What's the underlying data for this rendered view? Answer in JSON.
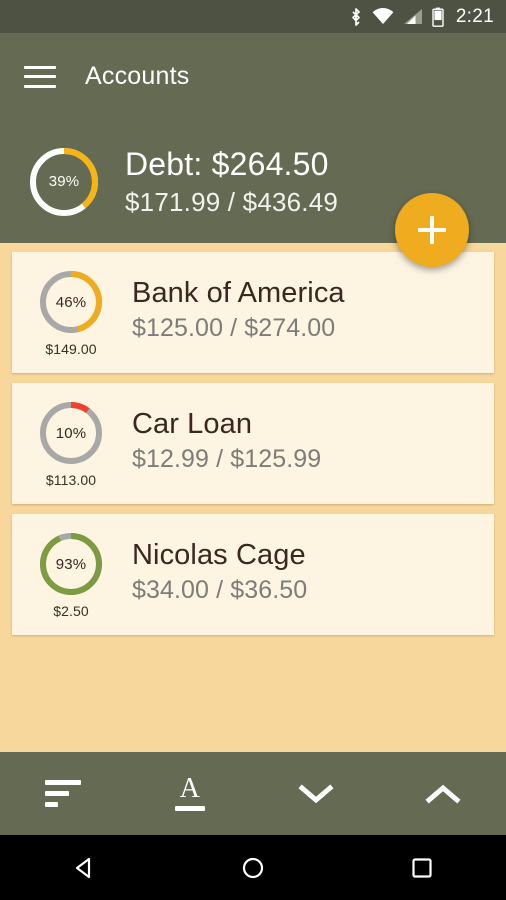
{
  "statusbar": {
    "time": "2:21",
    "icons": [
      "bluetooth-icon",
      "wifi-icon",
      "cell-signal-icon",
      "battery-icon"
    ]
  },
  "appbar": {
    "menu_icon": "hamburger-menu-icon",
    "title": "Accounts"
  },
  "summary": {
    "percent_label": "39%",
    "percent_value": 39,
    "title": "Debt: $264.50",
    "subtitle": "$171.99 / $436.49",
    "ring_track_color": "#FFFFFF",
    "ring_arc_color": "#F5B512"
  },
  "fab": {
    "icon": "plus-icon",
    "label": "+",
    "color": "#EFAC1E"
  },
  "accounts": [
    {
      "name": "Bank of America",
      "percent_label": "46%",
      "percent_value": 46,
      "remaining": "$149.00",
      "progress": "$125.00 / $274.00",
      "ring_arc_color": "#EFAC1E",
      "ring_track_color": "#A8A8A8"
    },
    {
      "name": "Car Loan",
      "percent_label": "10%",
      "percent_value": 10,
      "remaining": "$113.00",
      "progress": "$12.99 / $125.99",
      "ring_arc_color": "#F0412F",
      "ring_track_color": "#A8A8A8"
    },
    {
      "name": "Nicolas Cage",
      "percent_label": "93%",
      "percent_value": 93,
      "remaining": "$2.50",
      "progress": "$34.00 / $36.50",
      "ring_arc_color": "#7D9B40",
      "ring_track_color": "#A8A8A8"
    }
  ],
  "bottombar": {
    "buttons": [
      {
        "icon": "sort-lines-icon",
        "label": ""
      },
      {
        "icon": "sort-alphabetical-icon",
        "label": "A"
      },
      {
        "icon": "chevron-down-icon",
        "label": ""
      },
      {
        "icon": "chevron-up-icon",
        "label": ""
      }
    ]
  },
  "navbar": {
    "buttons": [
      "back-icon",
      "home-icon",
      "recents-icon"
    ]
  },
  "colors": {
    "statusbar_bg": "#4E5243",
    "appbar_bg": "#656A52",
    "page_bg": "#F7D79B",
    "card_bg": "#FDF4E2",
    "accent": "#EFAC1E"
  }
}
